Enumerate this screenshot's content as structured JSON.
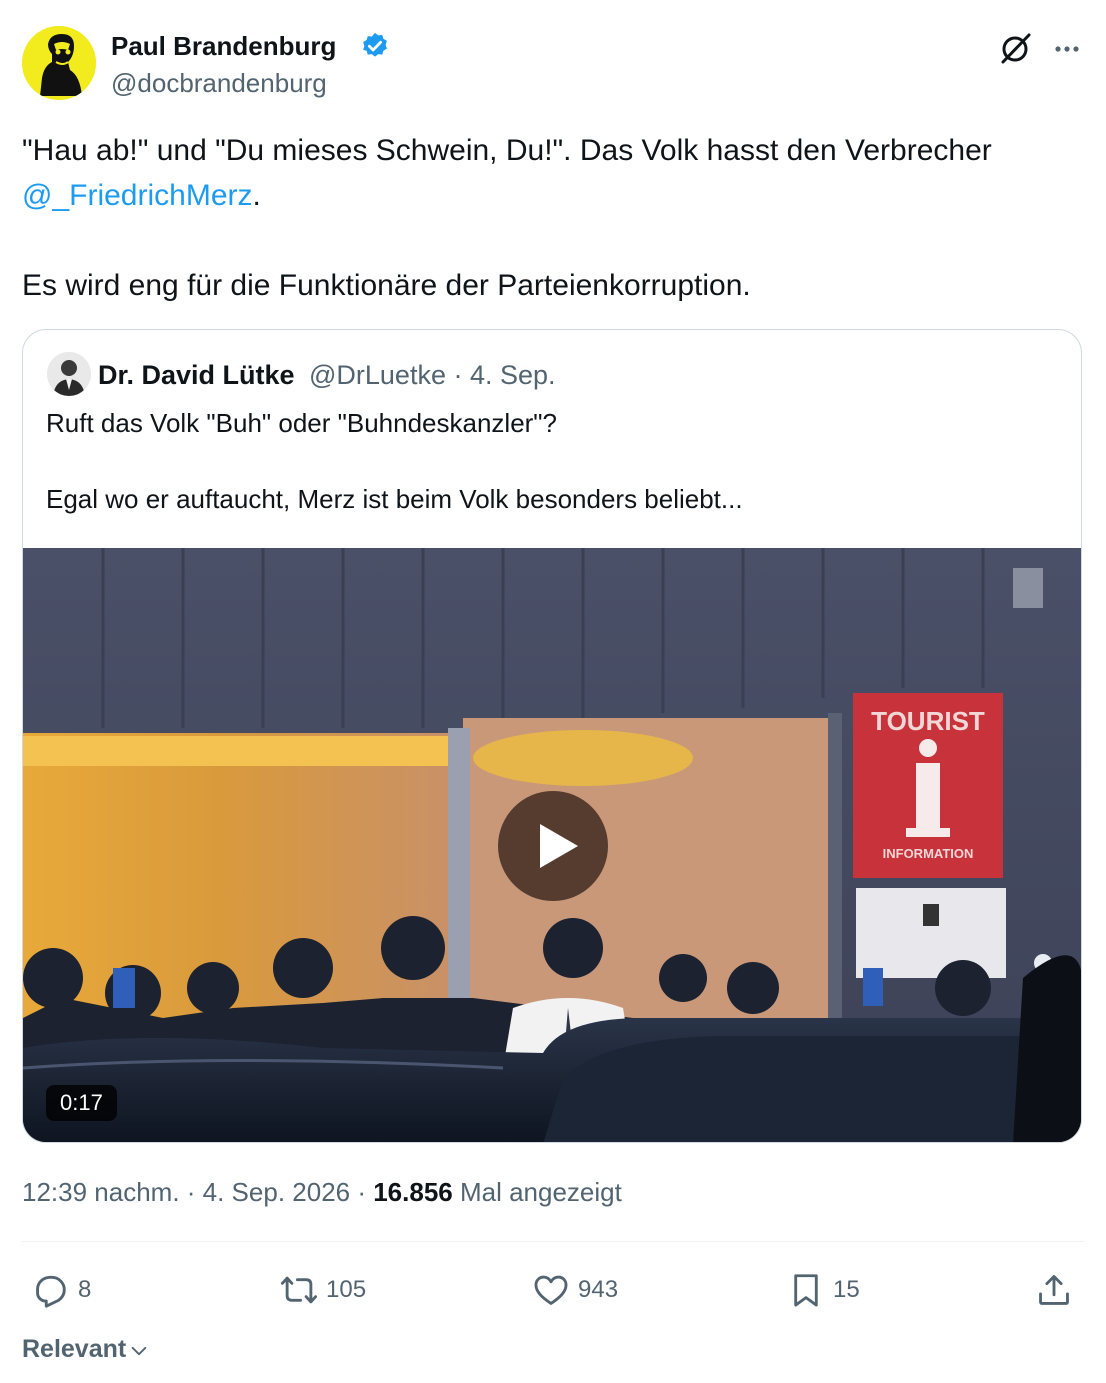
{
  "author": {
    "name": "Paul Brandenburg",
    "handle": "@docbrandenburg",
    "verified": true,
    "avatar_color": "#f2ec1e"
  },
  "header_icons": [
    "grok-icon",
    "more-icon"
  ],
  "tweet": {
    "line1": "\"Hau ab!\" und \"Du mieses Schwein, Du!\". Das Volk hasst den Verbrecher",
    "mention": "@_FriedrichMerz",
    "mention_suffix": ".",
    "line3": "Es wird eng für die Funktionäre der Parteienkorruption."
  },
  "quote": {
    "name": "Dr. David Lütke",
    "meta": "@DrLuetke · 4. Sep.",
    "line1": "Ruft das Volk \"Buh\" oder \"Buhndeskanzler\"?",
    "line2": "Egal wo er auftaucht, Merz ist beim Volk besonders beliebt...",
    "video": {
      "duration": "0:17",
      "sign_text_top": "TOURIST",
      "sign_text_bottom": "INFORMATION"
    }
  },
  "meta": {
    "time_date": "12:39 nachm. · 4. Sep. 2026 · ",
    "views": "16.856",
    "views_label": " Mal angezeigt"
  },
  "actions": {
    "replies": "8",
    "reposts": "105",
    "likes": "943",
    "bookmarks": "15"
  },
  "sort": {
    "label": "Relevant"
  },
  "colors": {
    "text": "#0f1419",
    "secondary": "#536471",
    "link": "#1d9bf0",
    "border": "#cfd9de"
  }
}
